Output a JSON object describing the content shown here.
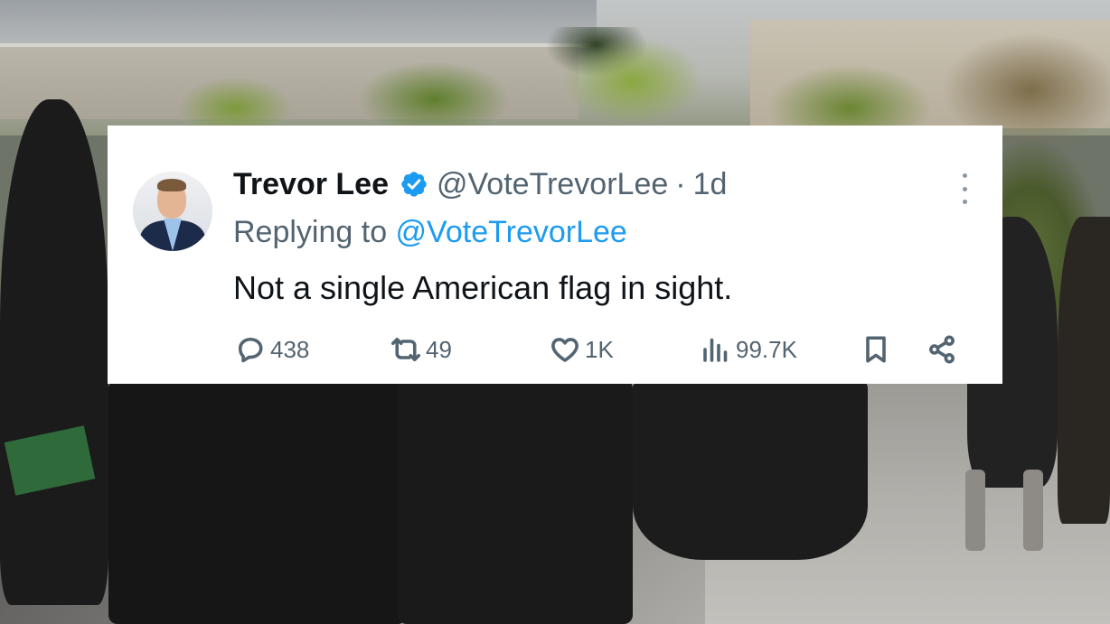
{
  "tweet": {
    "display_name": "Trevor Lee",
    "handle": "@VoteTrevorLee",
    "separator": "·",
    "time": "1d",
    "replying_prefix": "Replying to ",
    "replying_to": "@VoteTrevorLee",
    "text": "Not a single American flag in sight.",
    "verified": true,
    "stats": {
      "replies": "438",
      "retweets": "49",
      "likes": "1K",
      "views": "99.7K"
    }
  },
  "icons": {
    "verified": "verified-badge-icon",
    "more": "more-options-icon",
    "reply": "reply-bubble-icon",
    "retweet": "retweet-icon",
    "like": "heart-icon",
    "views": "views-bar-chart-icon",
    "bookmark": "bookmark-icon",
    "share": "share-icon"
  },
  "colors": {
    "card_background": "#ffffff",
    "primary_text": "#0f1419",
    "secondary_text": "#536471",
    "link_blue": "#1d9bf0",
    "verified_blue": "#1d9bf0"
  }
}
